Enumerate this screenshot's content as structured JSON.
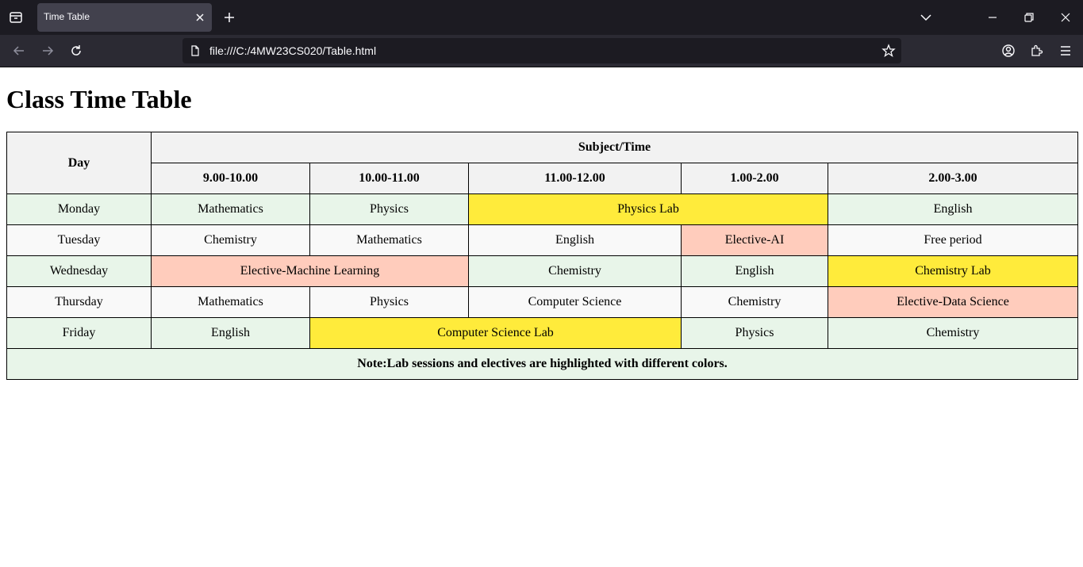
{
  "browser": {
    "tab_title": "Time Table",
    "url": "file:///C:/4MW23CS020/Table.html"
  },
  "page": {
    "title": "Class Time Table"
  },
  "table": {
    "header_day": "Day",
    "header_group": "Subject/Time",
    "time_slots": [
      "9.00-10.00",
      "10.00-11.00",
      "11.00-12.00",
      "1.00-2.00",
      "2.00-3.00"
    ],
    "rows": [
      {
        "day": "Monday",
        "cells": [
          "Mathematics",
          "Physics",
          "Physics Lab",
          "English"
        ]
      },
      {
        "day": "Tuesday",
        "cells": [
          "Chemistry",
          "Mathematics",
          "English",
          "Elective-AI",
          "Free period"
        ]
      },
      {
        "day": "Wednesday",
        "cells": [
          "Elective-Machine Learning",
          "Chemistry",
          "English",
          "Chemistry Lab"
        ]
      },
      {
        "day": "Thursday",
        "cells": [
          "Mathematics",
          "Physics",
          "Computer Science",
          "Chemistry",
          "Elective-Data Science"
        ]
      },
      {
        "day": "Friday",
        "cells": [
          "English",
          "Computer Science Lab",
          "Physics",
          "Chemistry"
        ]
      }
    ],
    "note": "Note:Lab sessions and electives are highlighted with different colors."
  },
  "colors": {
    "header_bg": "#f2f2f2",
    "odd_row_bg": "#e8f5e9",
    "even_row_bg": "#f9f9f9",
    "lab": "#ffeb3b",
    "elective": "#ffccbc"
  }
}
